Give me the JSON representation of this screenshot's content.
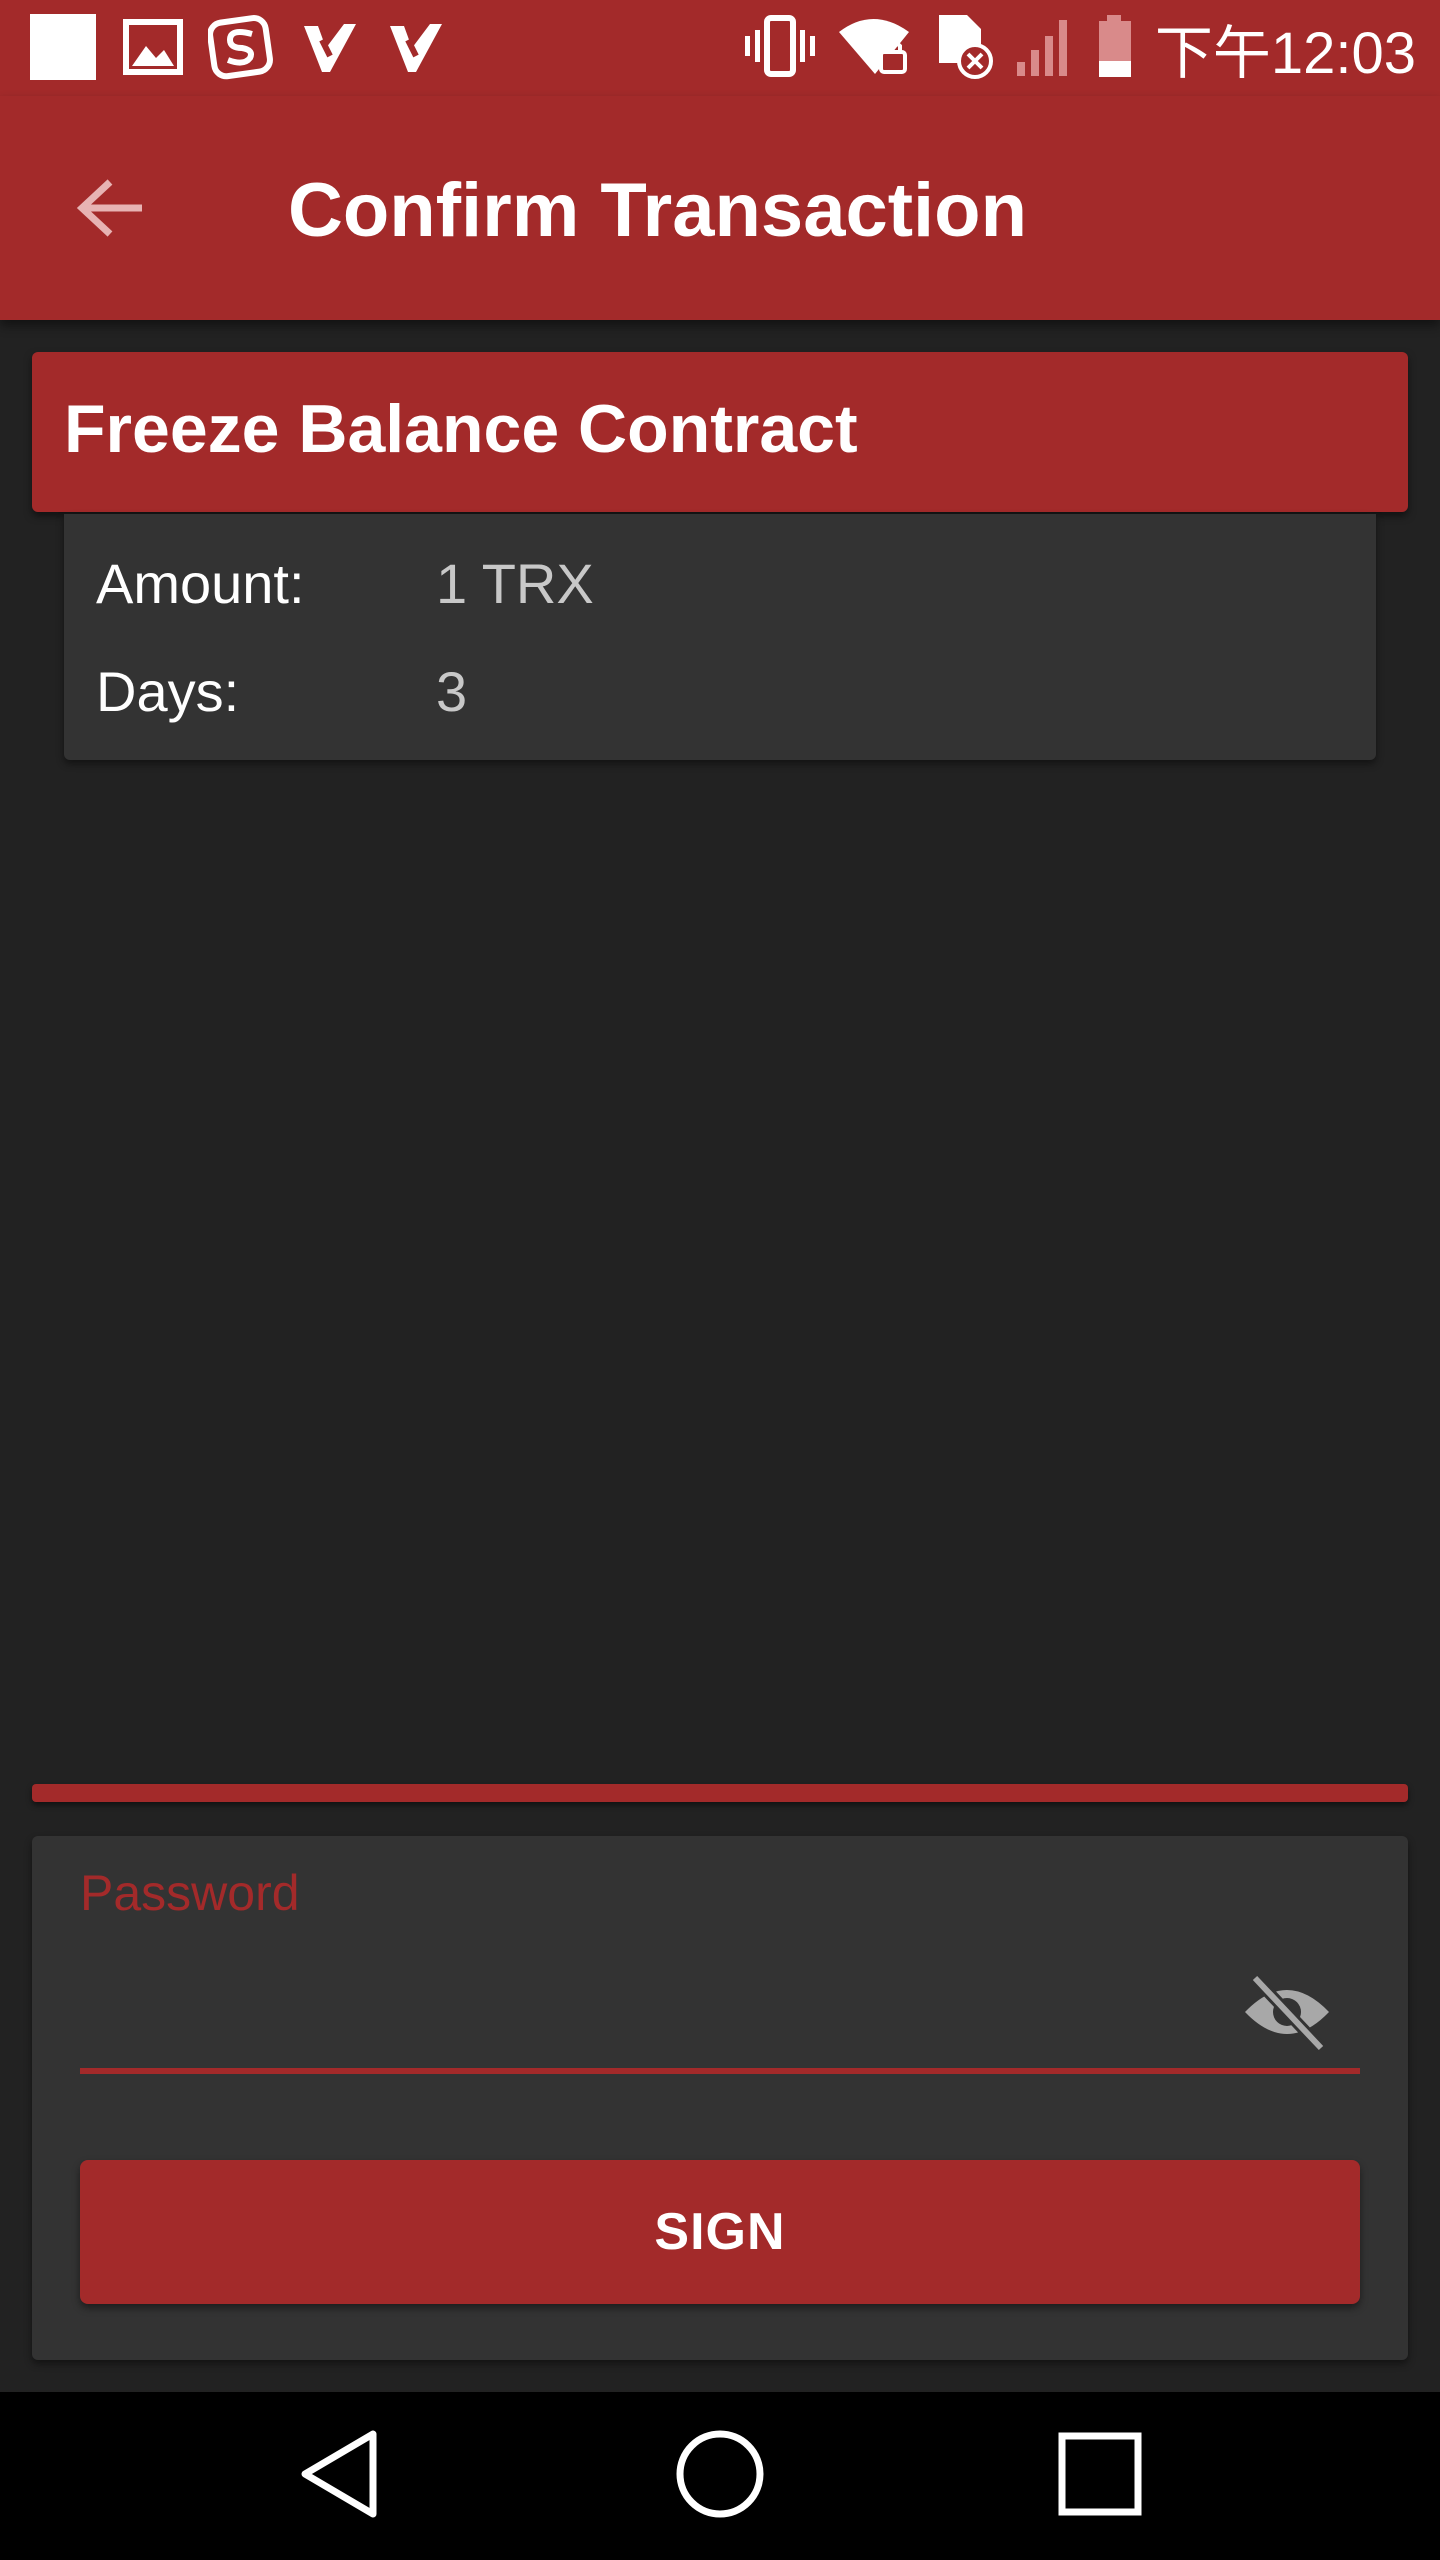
{
  "status_bar": {
    "time": "下午12:03",
    "left_icons": [
      "notification-square-icon",
      "image-icon",
      "sogou-s-icon",
      "check-app-icon",
      "check-app-icon"
    ],
    "right_icons": [
      "vibrate-icon",
      "wifi-locked-icon",
      "sim-error-icon",
      "signal-bars-icon",
      "battery-low-icon"
    ]
  },
  "app_bar": {
    "title": "Confirm Transaction",
    "back_icon": "arrow-back-icon"
  },
  "contract": {
    "title": "Freeze Balance Contract",
    "details": [
      {
        "label": "Amount:",
        "value": "1 TRX"
      },
      {
        "label": "Days:",
        "value": "3"
      }
    ]
  },
  "password": {
    "label": "Password",
    "value": "",
    "toggle_icon": "eye-off-icon"
  },
  "sign_button": {
    "label": "SIGN"
  },
  "nav_bar": {
    "buttons": [
      "back-triangle-icon",
      "home-circle-icon",
      "recents-square-icon"
    ]
  },
  "colors": {
    "accent": "#a32a2a",
    "background": "#222222",
    "card": "#333333",
    "navbar": "#000000"
  }
}
